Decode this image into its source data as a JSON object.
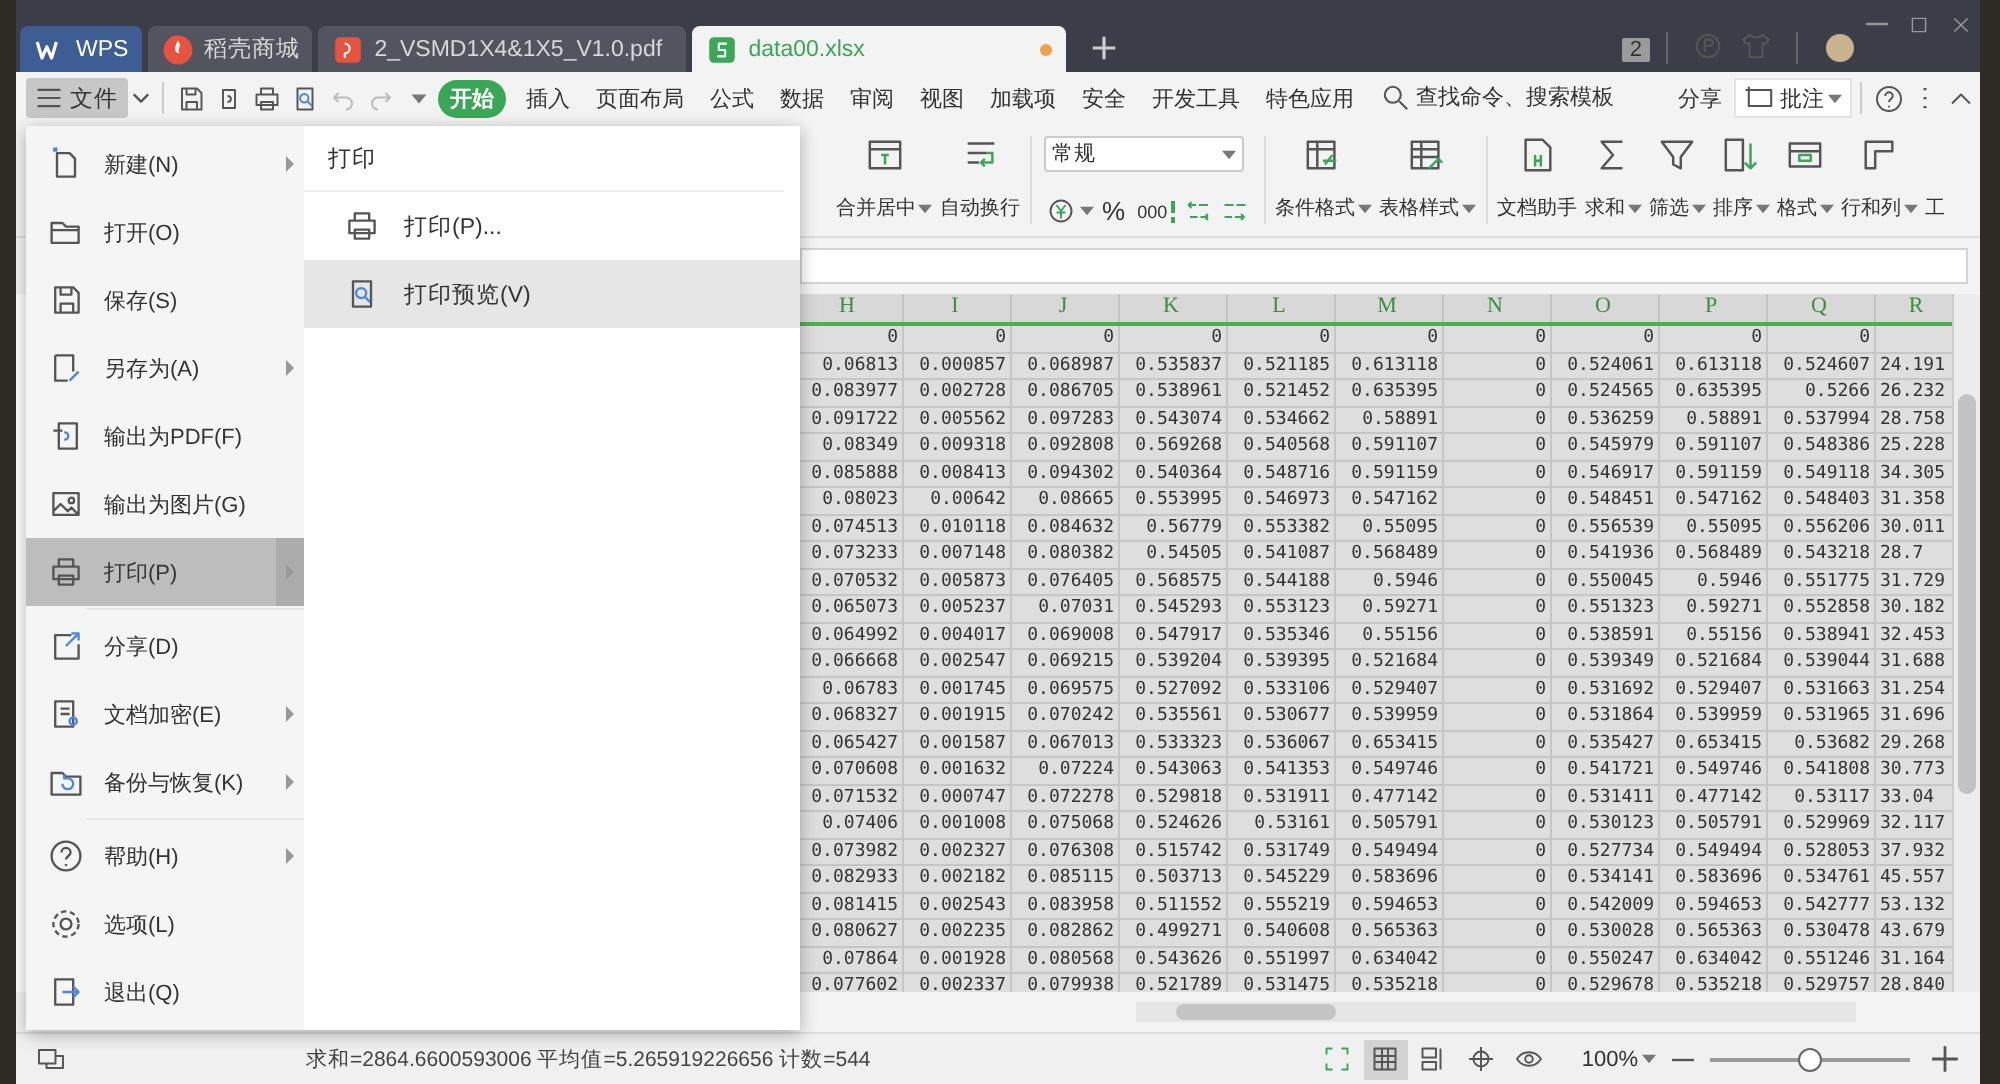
{
  "tabs": [
    {
      "label": "WPS",
      "kind": "home",
      "selected": false
    },
    {
      "label": "稻壳商城",
      "kind": "store",
      "selected": false
    },
    {
      "label": "2_VSMD1X4&1X5_V1.0.pdf",
      "kind": "pdf",
      "selected": false
    },
    {
      "label": "data00.xlsx",
      "kind": "sheet",
      "selected": true,
      "modified": true
    }
  ],
  "window_badge": "2",
  "file_button": {
    "label": "文件",
    "expanded": true
  },
  "ribbon_tabs": [
    {
      "label": "开始",
      "selected": true
    },
    {
      "label": "插入",
      "selected": false
    },
    {
      "label": "页面布局",
      "selected": false
    },
    {
      "label": "公式",
      "selected": false
    },
    {
      "label": "数据",
      "selected": false
    },
    {
      "label": "审阅",
      "selected": false
    },
    {
      "label": "视图",
      "selected": false
    },
    {
      "label": "加载项",
      "selected": false
    },
    {
      "label": "安全",
      "selected": false
    },
    {
      "label": "开发工具",
      "selected": false
    },
    {
      "label": "特色应用",
      "selected": false
    }
  ],
  "command_search": {
    "placeholder": "查找命令、搜索模板"
  },
  "share": "分享",
  "comment_button": "批注",
  "ribbon_left": [
    {
      "label": "合并居中",
      "kind": "merge",
      "dropdown": true
    },
    {
      "label": "自动换行",
      "kind": "wrap",
      "dropdown": false
    }
  ],
  "number_format": {
    "value": "常规",
    "percent": "%",
    "thousands": "000"
  },
  "ribbon_styles": [
    {
      "label": "条件格式",
      "kind": "cond",
      "dropdown": true
    },
    {
      "label": "表格样式",
      "kind": "tablestyle",
      "dropdown": true
    }
  ],
  "ribbon_right": [
    {
      "label": "文档助手",
      "kind": "assistant",
      "dropdown": false
    },
    {
      "label": "求和",
      "kind": "sum",
      "dropdown": true
    },
    {
      "label": "筛选",
      "kind": "filter",
      "dropdown": true
    },
    {
      "label": "排序",
      "kind": "sort",
      "dropdown": true
    },
    {
      "label": "格式",
      "kind": "format",
      "dropdown": true
    },
    {
      "label": "行和列",
      "kind": "rowcol",
      "dropdown": true
    },
    {
      "label": "工",
      "kind": "cut",
      "dropdown": false
    }
  ],
  "file_menu": {
    "groups": [
      [
        {
          "label": "新建(N)",
          "kind": "new",
          "submenu": true,
          "selected": false
        },
        {
          "label": "打开(O)",
          "kind": "open",
          "submenu": false,
          "selected": false
        },
        {
          "label": "保存(S)",
          "kind": "save",
          "submenu": false,
          "selected": false
        },
        {
          "label": "另存为(A)",
          "kind": "saveas",
          "submenu": true,
          "selected": false
        },
        {
          "label": "输出为PDF(F)",
          "kind": "pdf",
          "submenu": false,
          "selected": false
        },
        {
          "label": "输出为图片(G)",
          "kind": "image",
          "submenu": false,
          "selected": false
        },
        {
          "label": "打印(P)",
          "kind": "printer",
          "submenu": true,
          "selected": true
        }
      ],
      [
        {
          "label": "分享(D)",
          "kind": "share",
          "submenu": false,
          "selected": false
        },
        {
          "label": "文档加密(E)",
          "kind": "encrypt",
          "submenu": true,
          "selected": false
        },
        {
          "label": "备份与恢复(K)",
          "kind": "backup",
          "submenu": true,
          "selected": false
        }
      ],
      [
        {
          "label": "帮助(H)",
          "kind": "help",
          "submenu": true,
          "selected": false
        },
        {
          "label": "选项(L)",
          "kind": "options",
          "submenu": false,
          "selected": false
        },
        {
          "label": "退出(Q)",
          "kind": "exit",
          "submenu": false,
          "selected": false
        }
      ]
    ]
  },
  "print_submenu": {
    "title": "打印",
    "items": [
      {
        "label": "打印(P)...",
        "kind": "printer",
        "selected": false
      },
      {
        "label": "打印预览(V)",
        "kind": "preview",
        "selected": true
      }
    ]
  },
  "sheet": {
    "columns": [
      "H",
      "I",
      "J",
      "K",
      "L",
      "M",
      "N",
      "O",
      "P",
      "Q",
      "R"
    ],
    "rows": [
      [
        "0",
        "0",
        "0",
        "0",
        "0",
        "0",
        "0",
        "0",
        "0",
        "0"
      ],
      [
        "0.06813",
        "0.000857",
        "0.068987",
        "0.535837",
        "0.521185",
        "0.613118",
        "0",
        "0.524061",
        "0.613118",
        "0.524607",
        "24.191"
      ],
      [
        "0.083977",
        "0.002728",
        "0.086705",
        "0.538961",
        "0.521452",
        "0.635395",
        "0",
        "0.524565",
        "0.635395",
        "0.5266",
        "26.232"
      ],
      [
        "0.091722",
        "0.005562",
        "0.097283",
        "0.543074",
        "0.534662",
        "0.58891",
        "0",
        "0.536259",
        "0.58891",
        "0.537994",
        "28.758"
      ],
      [
        "0.08349",
        "0.009318",
        "0.092808",
        "0.569268",
        "0.540568",
        "0.591107",
        "0",
        "0.545979",
        "0.591107",
        "0.548386",
        "25.228"
      ],
      [
        "0.085888",
        "0.008413",
        "0.094302",
        "0.540364",
        "0.548716",
        "0.591159",
        "0",
        "0.546917",
        "0.591159",
        "0.549118",
        "34.305"
      ],
      [
        "0.08023",
        "0.00642",
        "0.08665",
        "0.553995",
        "0.546973",
        "0.547162",
        "0",
        "0.548451",
        "0.547162",
        "0.548403",
        "31.358"
      ],
      [
        "0.074513",
        "0.010118",
        "0.084632",
        "0.56779",
        "0.553382",
        "0.55095",
        "0",
        "0.556539",
        "0.55095",
        "0.556206",
        "30.011"
      ],
      [
        "0.073233",
        "0.007148",
        "0.080382",
        "0.54505",
        "0.541087",
        "0.568489",
        "0",
        "0.541936",
        "0.568489",
        "0.543218",
        "28.7"
      ],
      [
        "0.070532",
        "0.005873",
        "0.076405",
        "0.568575",
        "0.544188",
        "0.5946",
        "0",
        "0.550045",
        "0.5946",
        "0.551775",
        "31.729"
      ],
      [
        "0.065073",
        "0.005237",
        "0.07031",
        "0.545293",
        "0.553123",
        "0.59271",
        "0",
        "0.551323",
        "0.59271",
        "0.552858",
        "30.182"
      ],
      [
        "0.064992",
        "0.004017",
        "0.069008",
        "0.547917",
        "0.535346",
        "0.55156",
        "0",
        "0.538591",
        "0.55156",
        "0.538941",
        "32.453"
      ],
      [
        "0.066668",
        "0.002547",
        "0.069215",
        "0.539204",
        "0.539395",
        "0.521684",
        "0",
        "0.539349",
        "0.521684",
        "0.539044",
        "31.688"
      ],
      [
        "0.06783",
        "0.001745",
        "0.069575",
        "0.527092",
        "0.533106",
        "0.529407",
        "0",
        "0.531692",
        "0.529407",
        "0.531663",
        "31.254"
      ],
      [
        "0.068327",
        "0.001915",
        "0.070242",
        "0.535561",
        "0.530677",
        "0.539959",
        "0",
        "0.531864",
        "0.539959",
        "0.531965",
        "31.696"
      ],
      [
        "0.065427",
        "0.001587",
        "0.067013",
        "0.533323",
        "0.536067",
        "0.653415",
        "0",
        "0.535427",
        "0.653415",
        "0.53682",
        "29.268"
      ],
      [
        "0.070608",
        "0.001632",
        "0.07224",
        "0.543063",
        "0.541353",
        "0.549746",
        "0",
        "0.541721",
        "0.549746",
        "0.541808",
        "30.773"
      ],
      [
        "0.071532",
        "0.000747",
        "0.072278",
        "0.529818",
        "0.531911",
        "0.477142",
        "0",
        "0.531411",
        "0.477142",
        "0.53117",
        "33.04"
      ],
      [
        "0.07406",
        "0.001008",
        "0.075068",
        "0.524626",
        "0.53161",
        "0.505791",
        "0",
        "0.530123",
        "0.505791",
        "0.529969",
        "32.117"
      ],
      [
        "0.073982",
        "0.002327",
        "0.076308",
        "0.515742",
        "0.531749",
        "0.549494",
        "0",
        "0.527734",
        "0.549494",
        "0.528053",
        "37.932"
      ],
      [
        "0.082933",
        "0.002182",
        "0.085115",
        "0.503713",
        "0.545229",
        "0.583696",
        "0",
        "0.534141",
        "0.583696",
        "0.534761",
        "45.557"
      ],
      [
        "0.081415",
        "0.002543",
        "0.083958",
        "0.511552",
        "0.555219",
        "0.594653",
        "0",
        "0.542009",
        "0.594653",
        "0.542777",
        "53.132"
      ],
      [
        "0.080627",
        "0.002235",
        "0.082862",
        "0.499271",
        "0.540608",
        "0.565363",
        "0",
        "0.530028",
        "0.565363",
        "0.530478",
        "43.679"
      ],
      [
        "0.07864",
        "0.001928",
        "0.080568",
        "0.543626",
        "0.551997",
        "0.634042",
        "0",
        "0.550247",
        "0.634042",
        "0.551246",
        "31.164"
      ],
      [
        "0.077602",
        "0.002337",
        "0.079938",
        "0.521789",
        "0.531475",
        "0.535218",
        "0",
        "0.529678",
        "0.535218",
        "0.529757",
        "28.840"
      ]
    ]
  },
  "status_bar": {
    "summary": "求和=2864.6600593006 平均值=5.265919226656 计数=544",
    "views": [
      {
        "kind": "fullscreen",
        "selected": false
      },
      {
        "kind": "normal",
        "selected": true
      },
      {
        "kind": "pagebreak",
        "selected": false
      },
      {
        "kind": "reading",
        "selected": false
      },
      {
        "kind": "eye",
        "selected": false
      }
    ],
    "zoom": "100%",
    "zoom_slider": {
      "level": 0.5
    }
  }
}
